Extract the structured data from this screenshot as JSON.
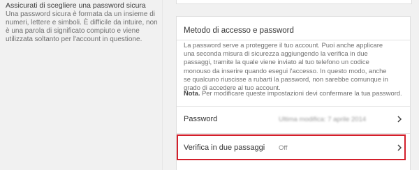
{
  "left_panel": {
    "title": "Assicurati di scegliere una password sicura",
    "description": "Una password sicura è formata da un insieme di numeri, lettere e simboli. È difficile da intuire, non è una parola di significato compiuto e viene utilizzata soltanto per l'account in questione."
  },
  "card": {
    "title": "Metodo di accesso e password",
    "description": "La password serve a proteggere il tuo account. Puoi anche applicare una seconda misura di sicurezza aggiungendo la verifica in due passaggi, tramite la quale viene inviato al tuo telefono un codice monouso da inserire quando esegui l'accesso. In questo modo, anche se qualcuno riuscisse a rubarti la password, non sarebbe comunque in grado di accedere al tuo account.",
    "note_label": "Nota.",
    "note_text": " Per modificare queste impostazioni devi confermare la tua password.",
    "rows": [
      {
        "label": "Password",
        "value": "Ultima modifica: 7 aprile 2014",
        "icon": "chevron-right-icon"
      },
      {
        "label": "Verifica in due passaggi",
        "value": "Off",
        "icon": "chevron-right-icon"
      }
    ]
  },
  "colors": {
    "highlight": "#d31f2b",
    "background": "#f1f1f1",
    "card": "#ffffff"
  }
}
